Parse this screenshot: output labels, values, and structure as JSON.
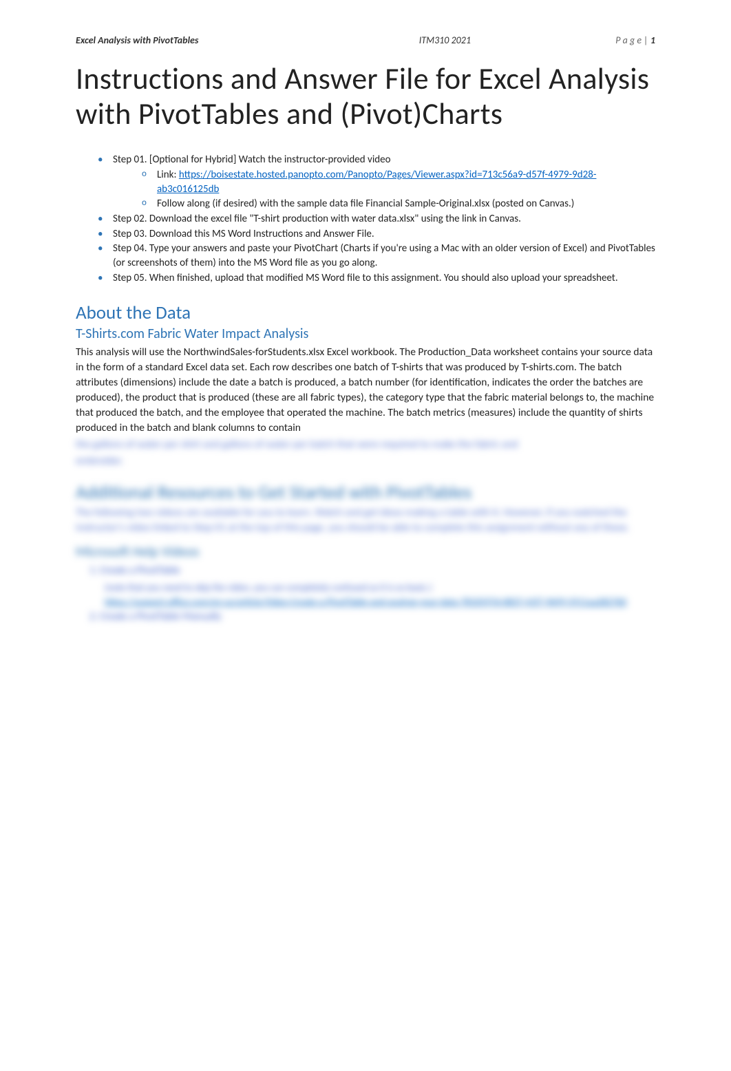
{
  "header": {
    "left": "Excel Analysis with PivotTables",
    "center": "ITM310 2021",
    "right_label": "P a g e | ",
    "right_num": "1"
  },
  "title": "Instructions and Answer File for Excel Analysis with PivotTables and (Pivot)Charts",
  "steps": [
    {
      "text": "Step 01. [Optional for Hybrid] Watch the instructor-provided video",
      "subs": [
        {
          "prefix": "Link: ",
          "link": "https://boisestate.hosted.panopto.com/Panopto/Pages/Viewer.aspx?id=713c56a9-d57f-4979-9d28-ab3c016125db"
        },
        {
          "text": "Follow along (if desired) with the sample data file Financial Sample-Original.xlsx (posted on Canvas.)"
        }
      ]
    },
    {
      "text": "Step 02. Download the excel file \"T-shirt production with water data.xlsx\" using the link in Canvas."
    },
    {
      "text": "Step 03. Download this MS Word Instructions and Answer File."
    },
    {
      "text": "Step 04. Type your answers and paste your PivotChart (Charts if you're using a Mac with an older version of Excel) and PivotTables (or screenshots of them) into the MS Word file as you go along."
    },
    {
      "text": "Step 05. When finished, upload that modified MS Word file to this assignment. You should also upload your spreadsheet."
    }
  ],
  "about": {
    "heading": "About the Data",
    "subheading": "T-Shirts.com Fabric Water Impact Analysis",
    "body_visible": "This analysis will use the NorthwindSales-forStudents.xlsx Excel workbook. The Production_Data worksheet contains your source data in the form of a standard Excel data set. Each row describes one batch of T-shirts that was produced by T-shirts.com. The batch attributes (dimensions) include the date a batch is produced, a batch number (for identification, indicates the order the batches are produced), the product that is produced (these are all fabric types), the category type that the fabric material belongs to, the machine that produced the batch, and the employee that operated the machine. The batch metrics (measures) include the quantity of shirts produced in the batch and blank columns to contain",
    "body_blurred_1": "the gallons of water per shirt and gallons of water per batch that were required to make the fabric and",
    "body_blurred_2": "embroider."
  },
  "resources": {
    "heading": "Additional Resources to Get Started with PivotTables",
    "intro": "The following two videos are available for you to learn. Watch and get ideas making a table with it. However, if you watched the instructor's video linked to Step 01 at the top of this page, you should be able to complete this assignment without any of these.",
    "vid_heading": "Microsoft Help Videos",
    "item1": "1.  Create a PivotTable",
    "sub1a": "(note that you need to skip the video, you can completely confused as it is so basic.)",
    "sub1b_link": "https://support.office.com/en-us/article/Video-Create-a-PivotTable-and-analyze-your-data-7810597d-0837-41f7-9699-5911aa282760",
    "item2": "2.  Create a PivotTable Manually"
  }
}
